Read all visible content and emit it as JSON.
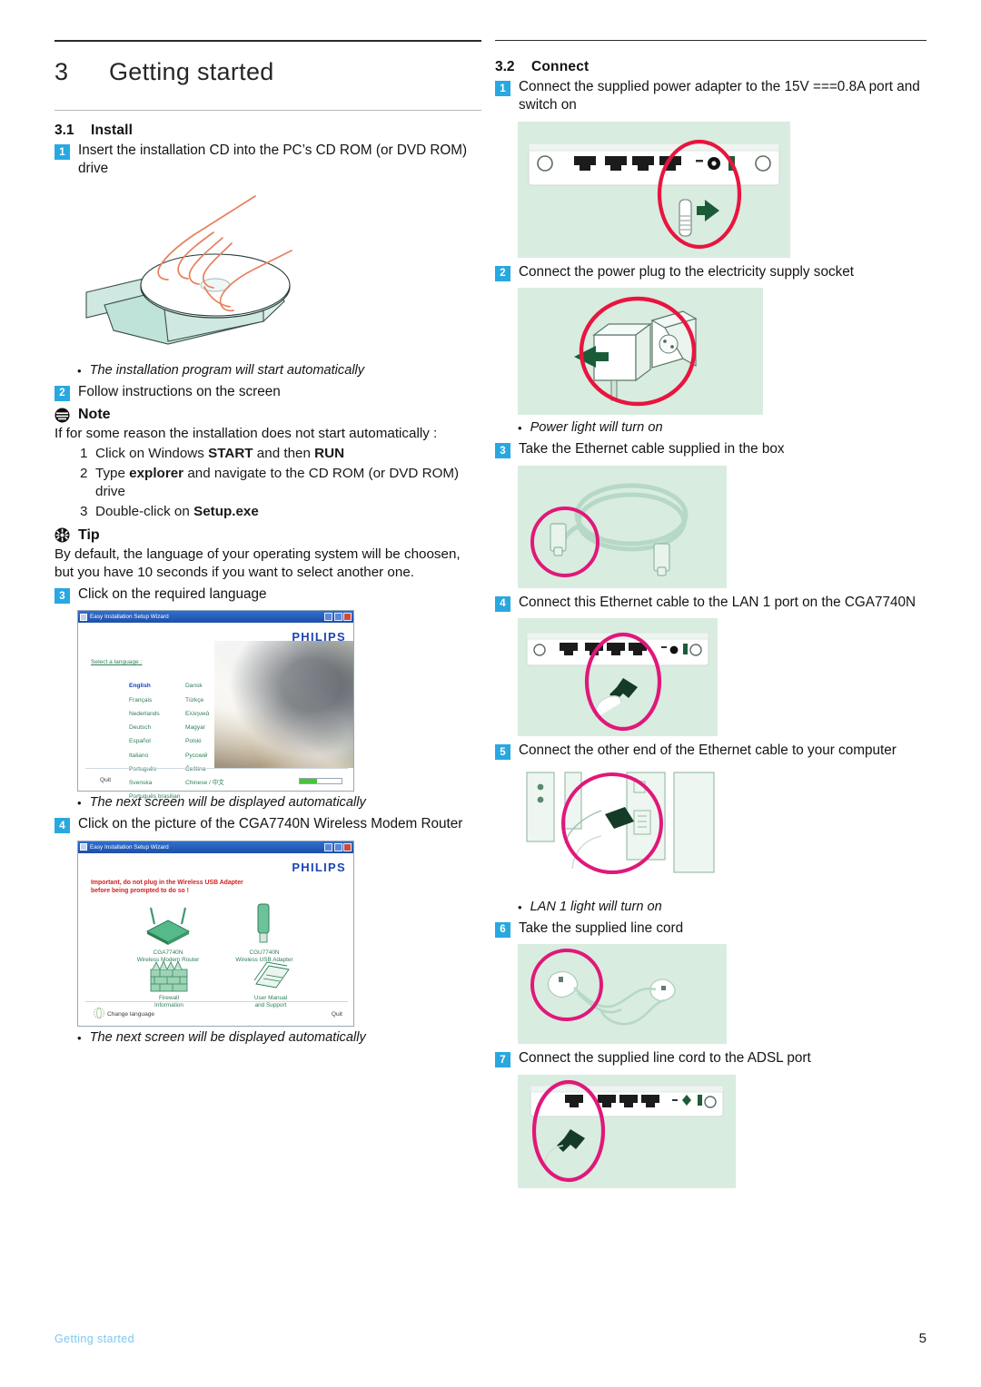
{
  "chapter": {
    "number": "3",
    "title": "Getting started"
  },
  "left": {
    "section": {
      "number": "3.1",
      "name": "Install"
    },
    "step1": {
      "badge": "1",
      "text": "Insert the installation CD into the PC’s CD ROM (or DVD ROM) drive"
    },
    "caption1": "The installation program will start automatically",
    "step2": {
      "badge": "2",
      "text": "Follow instructions on the screen"
    },
    "note": {
      "title": "Note",
      "intro": "If for some reason the installation does not start automatically :",
      "items": [
        {
          "n": "1",
          "pre": "Click on Windows ",
          "bold": "START",
          "mid": " and then ",
          "bold2": "RUN",
          "post": ""
        },
        {
          "n": "2",
          "pre": "Type ",
          "bold": "explorer",
          "mid": " and navigate to the CD ROM (or DVD ROM) drive",
          "bold2": "",
          "post": ""
        },
        {
          "n": "3",
          "pre": "Double-click on ",
          "bold": "Setup.exe",
          "mid": "",
          "bold2": "",
          "post": ""
        }
      ]
    },
    "tip": {
      "title": "Tip",
      "text": "By default, the language of your operating system will be choosen, but you have 10 seconds if you want to select another one."
    },
    "step3": {
      "badge": "3",
      "text": "Click on the required language"
    },
    "wizard1": {
      "window_title": "Easy Installation Setup Wizard",
      "brand": "PHILIPS",
      "prompt": "Select a language :",
      "languages_col1": [
        "English",
        "Français",
        "Nederlands",
        "Deutsch",
        "Español",
        "Italiano",
        "Português",
        "Svenska",
        "Português brasilian"
      ],
      "languages_col2": [
        "Dansk",
        "Türkçe",
        "Ελληνικά",
        "Magyar",
        "Polski",
        "Русский",
        "Čeština",
        "Chinese / 中文"
      ],
      "quit": "Quit"
    },
    "caption2": "The next screen will be displayed automatically",
    "step4": {
      "badge": "4",
      "text": "Click on the picture of the CGA7740N Wireless Modem Router"
    },
    "wizard2": {
      "window_title": "Easy Installation Setup Wizard",
      "brand": "PHILIPS",
      "warning": "Important, do not plug in the Wireless USB Adapter before being prompted to do so !",
      "tiles": [
        {
          "title": "CGA7740N",
          "subtitle": "Wireless Modem Router"
        },
        {
          "title": "CGU7740N",
          "subtitle": "Wireless USB Adapter"
        },
        {
          "title": "Firewall",
          "subtitle": "Information"
        },
        {
          "title": "User Manual",
          "subtitle": "and Support"
        }
      ],
      "change_language": "Change language",
      "quit": "Quit"
    },
    "caption3": "The next screen will be displayed automatically"
  },
  "right": {
    "section": {
      "number": "3.2",
      "name": "Connect"
    },
    "step1": {
      "badge": "1",
      "text": "Connect the supplied power adapter to the 15V ===0.8A port and switch on"
    },
    "step2": {
      "badge": "2",
      "text": "Connect the power plug to the electricity supply socket"
    },
    "caption_power": "Power light will turn on",
    "step3": {
      "badge": "3",
      "text": "Take the Ethernet cable supplied in the box"
    },
    "step4": {
      "badge": "4",
      "text": "Connect this Ethernet cable to the LAN 1 port on the CGA7740N"
    },
    "step5": {
      "badge": "5",
      "text": "Connect the other end of the Ethernet cable to your computer"
    },
    "caption_lan": "LAN 1 light will turn on",
    "step6": {
      "badge": "6",
      "text": "Take the supplied line cord"
    },
    "step7": {
      "badge": "7",
      "text": "Connect the supplied line cord to the ADSL port"
    }
  },
  "footer": {
    "left": "Getting  started",
    "page": "5"
  },
  "colors": {
    "badge_blue": "#29a8e0",
    "figure_green": "#d9ece0",
    "highlight_red": "#e8153f",
    "highlight_magenta": "#e0187a",
    "philips_blue": "#1b45b5",
    "footer_blue": "#7ec7f0"
  }
}
